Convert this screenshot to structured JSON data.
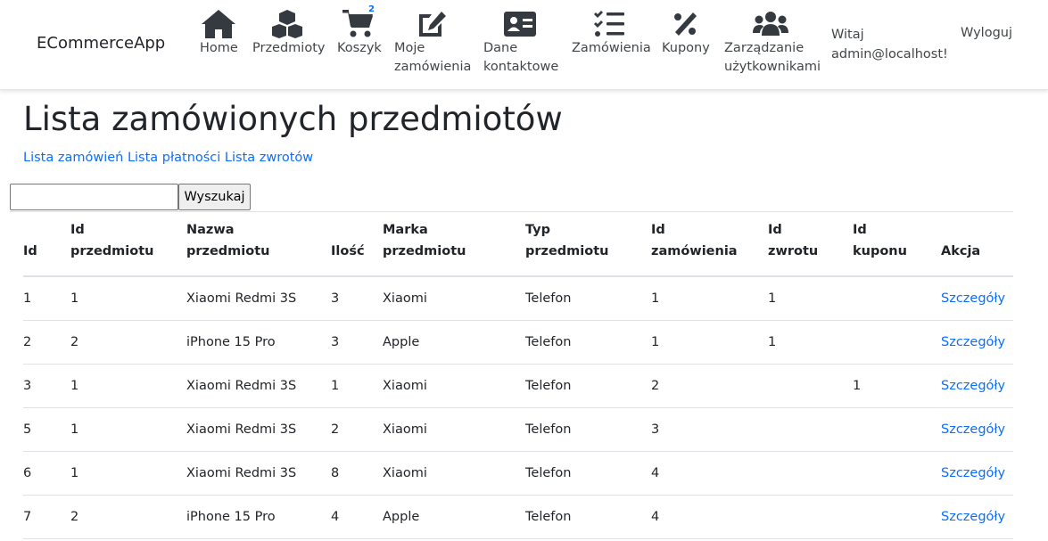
{
  "brand": "ECommerceApp",
  "nav": {
    "items": [
      {
        "label": "Home",
        "icon": "home-icon"
      },
      {
        "label": "Przedmioty",
        "icon": "cubes-icon"
      },
      {
        "label": "Koszyk",
        "icon": "cart-icon",
        "badge": "2"
      },
      {
        "label": "Moje\nzamówienia",
        "icon": "edit-icon"
      },
      {
        "label": "Dane\nkontaktowe",
        "icon": "address-card-icon"
      },
      {
        "label": "Zamówienia",
        "icon": "list-check-icon"
      },
      {
        "label": "Kupony",
        "icon": "percent-icon"
      },
      {
        "label": "Zarządzanie\nużytkownikami",
        "icon": "users-icon"
      }
    ],
    "greeting": "Witaj\nadmin@localhost!",
    "logout": "Wyloguj"
  },
  "page": {
    "title": "Lista zamówionych przedmiotów",
    "links": [
      "Lista zamówień",
      "Lista płatności",
      "Lista zwrotów"
    ],
    "search": {
      "value": "",
      "placeholder": "",
      "button": "Wyszukaj"
    }
  },
  "table": {
    "headers": [
      "Id",
      "Id\nprzedmiotu",
      "Nazwa\nprzedmiotu",
      "Ilość",
      "Marka\nprzedmiotu",
      "Typ\nprzedmiotu",
      "Id\nzamówienia",
      "Id\nzwrotu",
      "Id\nkuponu",
      "Akcja"
    ],
    "rows": [
      [
        "1",
        "1",
        "Xiaomi Redmi 3S",
        "3",
        "Xiaomi",
        "Telefon",
        "1",
        "1",
        "",
        "Szczegóły"
      ],
      [
        "2",
        "2",
        "iPhone 15 Pro",
        "3",
        "Apple",
        "Telefon",
        "1",
        "1",
        "",
        "Szczegóły"
      ],
      [
        "3",
        "1",
        "Xiaomi Redmi 3S",
        "1",
        "Xiaomi",
        "Telefon",
        "2",
        "",
        "1",
        "Szczegóły"
      ],
      [
        "5",
        "1",
        "Xiaomi Redmi 3S",
        "2",
        "Xiaomi",
        "Telefon",
        "3",
        "",
        "",
        "Szczegóły"
      ],
      [
        "6",
        "1",
        "Xiaomi Redmi 3S",
        "8",
        "Xiaomi",
        "Telefon",
        "4",
        "",
        "",
        "Szczegóły"
      ],
      [
        "7",
        "2",
        "iPhone 15 Pro",
        "4",
        "Apple",
        "Telefon",
        "4",
        "",
        "",
        "Szczegóły"
      ]
    ]
  },
  "colors": {
    "link": "#0d6efd",
    "text": "#212529",
    "icon": "#343a40",
    "border": "#dee2e6"
  }
}
